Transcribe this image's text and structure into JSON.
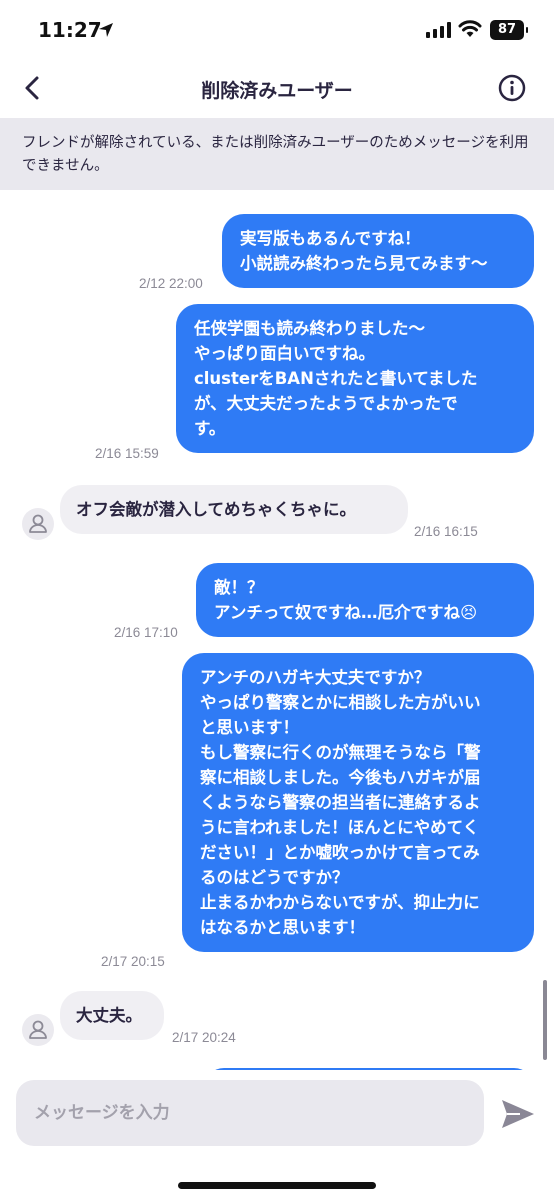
{
  "status_bar": {
    "time": "11:27",
    "battery": "87"
  },
  "header": {
    "title": "削除済みユーザー"
  },
  "notice": {
    "text": "フレンドが解除されている、または削除済みユーザーのためメッセージを利用できません。"
  },
  "messages": [
    {
      "direction": "out",
      "text": "実写版もあるんですね！\n小説読み終わったら見てみます〜",
      "time": "2/12 22:00"
    },
    {
      "direction": "out",
      "text": "任侠学園も読み終わりました〜\nやっぱり面白いですね。\nclusterをBANされたと書いてました\nが、大丈夫だったようでよかったで\nす。",
      "time": "2/16 15:59"
    },
    {
      "direction": "in",
      "text": "オフ会敵が潜入してめちゃくちゃに。",
      "time": "2/16 16:15"
    },
    {
      "direction": "out",
      "text": "敵！？\nアンチって奴ですね…厄介ですね😣",
      "time": "2/16 17:10"
    },
    {
      "direction": "out",
      "text": "アンチのハガキ大丈夫ですか？\nやっぱり警察とかに相談した方がいい\nと思います！\nもし警察に行くのが無理そうなら「警\n察に相談しました。今後もハガキが届\nくようなら警察の担当者に連絡するよ\nうに言われました！ほんとにやめてく\nださい！」とか嘘吹っかけて言ってみ\nるのはどうですか？\n止まるかわからないですが、抑止力に\nはなるかと思います！",
      "time": "2/17 20:15"
    },
    {
      "direction": "in",
      "text": "大丈夫。",
      "time": "2/17 20:24"
    }
  ],
  "composer": {
    "placeholder": "メッセージを入力"
  },
  "colors": {
    "outgoing_bubble": "#2f7bf5",
    "incoming_bubble": "#f0eff3",
    "notice_bg": "#e9e8ee",
    "text": "#2a2540"
  },
  "icons": {
    "back": "chevron-left-icon",
    "info": "info-circle-icon",
    "send": "send-arrow-icon",
    "avatar": "person-icon"
  }
}
